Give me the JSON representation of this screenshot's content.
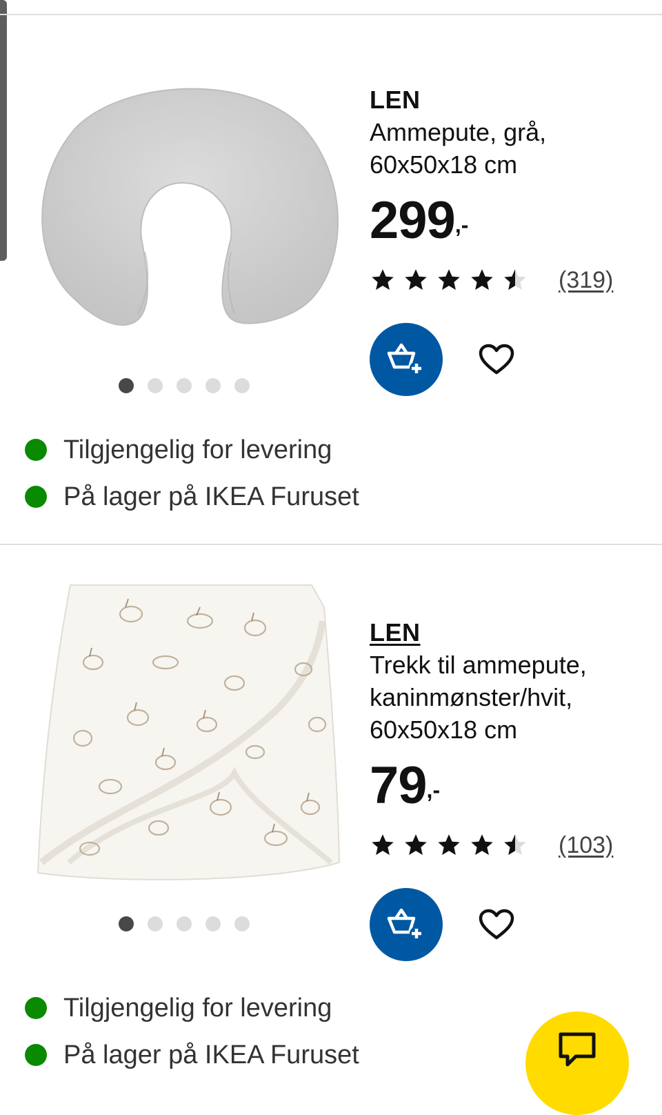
{
  "products": [
    {
      "brand": "LEN",
      "description": "Ammepute, grå, 60x50x18 cm",
      "price": "299",
      "price_suffix": ",-",
      "rating": 4.5,
      "review_count": "(319)",
      "image_icon": "nursing-pillow-image",
      "carousel_dots": 5,
      "carousel_active": 1,
      "availability": [
        {
          "text": "Tilgjengelig for levering",
          "color": "#0a8a00"
        },
        {
          "text": "På lager på IKEA Furuset",
          "color": "#0a8a00"
        }
      ]
    },
    {
      "brand": "LEN",
      "description": "Trekk til ammepute, kaninmønster/hvit, 60x50x18 cm",
      "price": "79",
      "price_suffix": ",-",
      "rating": 4.5,
      "review_count": "(103)",
      "image_icon": "pillow-cover-image",
      "carousel_dots": 5,
      "carousel_active": 1,
      "availability": [
        {
          "text": "Tilgjengelig for levering",
          "color": "#0a8a00"
        },
        {
          "text": "På lager på IKEA Furuset",
          "color": "#0a8a00"
        }
      ]
    }
  ],
  "icons": {
    "add_to_cart": "add-to-cart-icon",
    "favourite": "heart-icon",
    "chat": "chat-icon",
    "star": "star-icon"
  },
  "colors": {
    "brand_blue": "#0058a3",
    "chat_yellow": "#ffdb00",
    "in_stock_green": "#0a8a00"
  }
}
